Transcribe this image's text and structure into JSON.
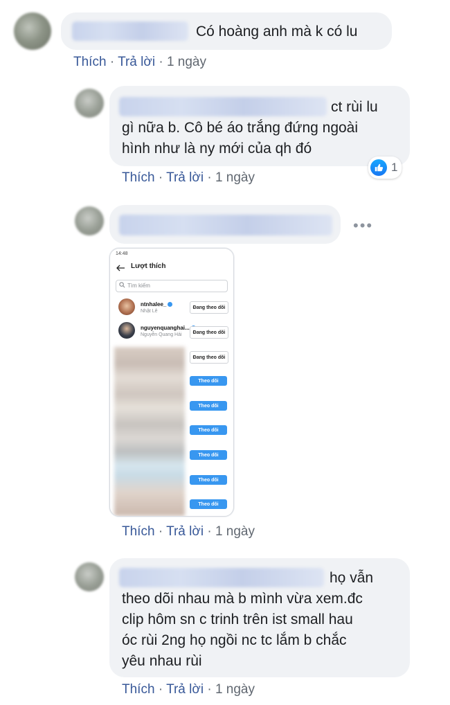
{
  "comments": [
    {
      "text": "Có hoàng anh mà k có lu",
      "actions": {
        "like": "Thích",
        "reply": "Trả lời",
        "time": "1 ngày"
      }
    },
    {
      "text_lines": [
        "ct rùi lu",
        "gì nữa b. Cô bé áo trắng đứng ngoài",
        "hình như là ny mới của qh đó"
      ],
      "reaction": {
        "icon": "like-icon",
        "count": "1"
      },
      "actions": {
        "like": "Thích",
        "reply": "Trả lời",
        "time": "1 ngày"
      }
    },
    {
      "more": "•••",
      "actions": {
        "like": "Thích",
        "reply": "Trả lời",
        "time": "1 ngày"
      }
    },
    {
      "text_lines": [
        "họ vẫn",
        "theo dõi nhau mà b mình vừa xem.đc",
        "clip hôm sn c trinh trên ist small hau",
        "óc rùi 2ng họ ngồi nc tc lắm b chắc",
        "yêu nhau rùi"
      ],
      "actions": {
        "like": "Thích",
        "reply": "Trả lời",
        "time": "1 ngày"
      }
    }
  ],
  "separator": "·",
  "phone": {
    "status_time": "14:48",
    "title": "Lượt thích",
    "search_placeholder": "Tìm kiếm",
    "users": [
      {
        "username": "ntnhalee_",
        "fullname": "Nhật Lê",
        "button": "Đang theo dõi"
      },
      {
        "username": "nguyenquanghai...",
        "fullname": "Nguyễn Quang Hải",
        "button": "Đang theo dõi"
      }
    ],
    "more_buttons": [
      "Đang theo dõi",
      "Theo dõi",
      "Theo dõi",
      "Theo dõi",
      "Theo dõi",
      "Theo dõi",
      "Theo dõi"
    ]
  },
  "colors": {
    "link": "#385898",
    "bubble": "#f0f2f5",
    "follow_button": "#3897f0",
    "like": "#1877f2"
  }
}
